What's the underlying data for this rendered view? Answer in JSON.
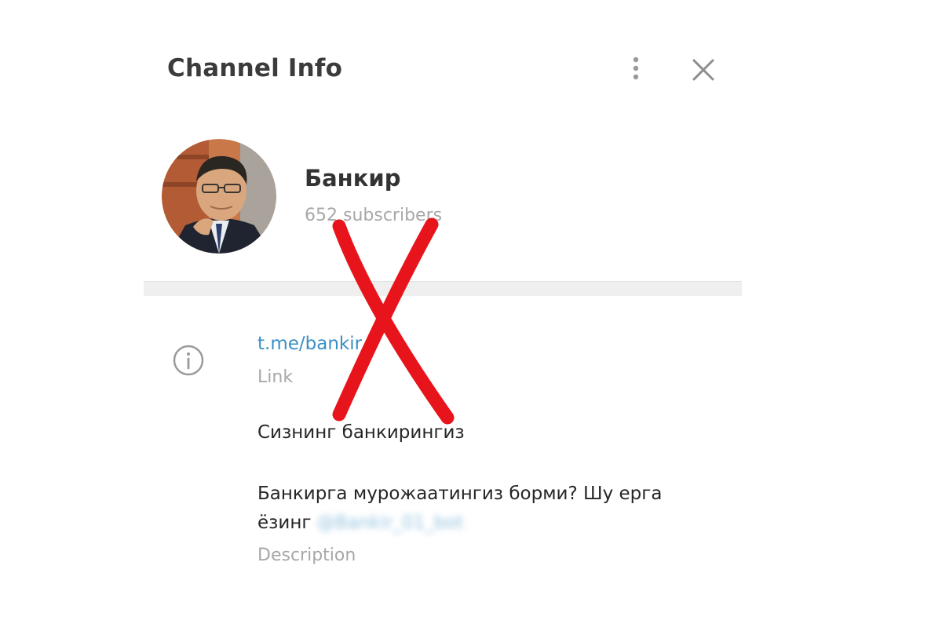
{
  "header": {
    "title": "Channel Info",
    "menu_icon": "more-vertical-icon",
    "close_icon": "close-icon"
  },
  "channel": {
    "name": "Банкир",
    "subscribers": "652 subscribers"
  },
  "info": {
    "icon": "info-icon",
    "link_value": "t.me/bankir",
    "link_caption": "Link",
    "description_line1": "Сизнинг банкирингиз",
    "description_line2": "Банкирга мурожаатингиз борми? Шу ерга",
    "description_line3_prefix": "ёзинг ",
    "description_mention": "@Bankir_01_bot",
    "description_caption": "Description"
  },
  "overlay": {
    "mark": "red-x-mark",
    "color": "#e8141c"
  },
  "colors": {
    "accent_link": "#3a8fc4",
    "secondary_text": "#a8a8a8",
    "title_text": "#3b3b3b"
  }
}
